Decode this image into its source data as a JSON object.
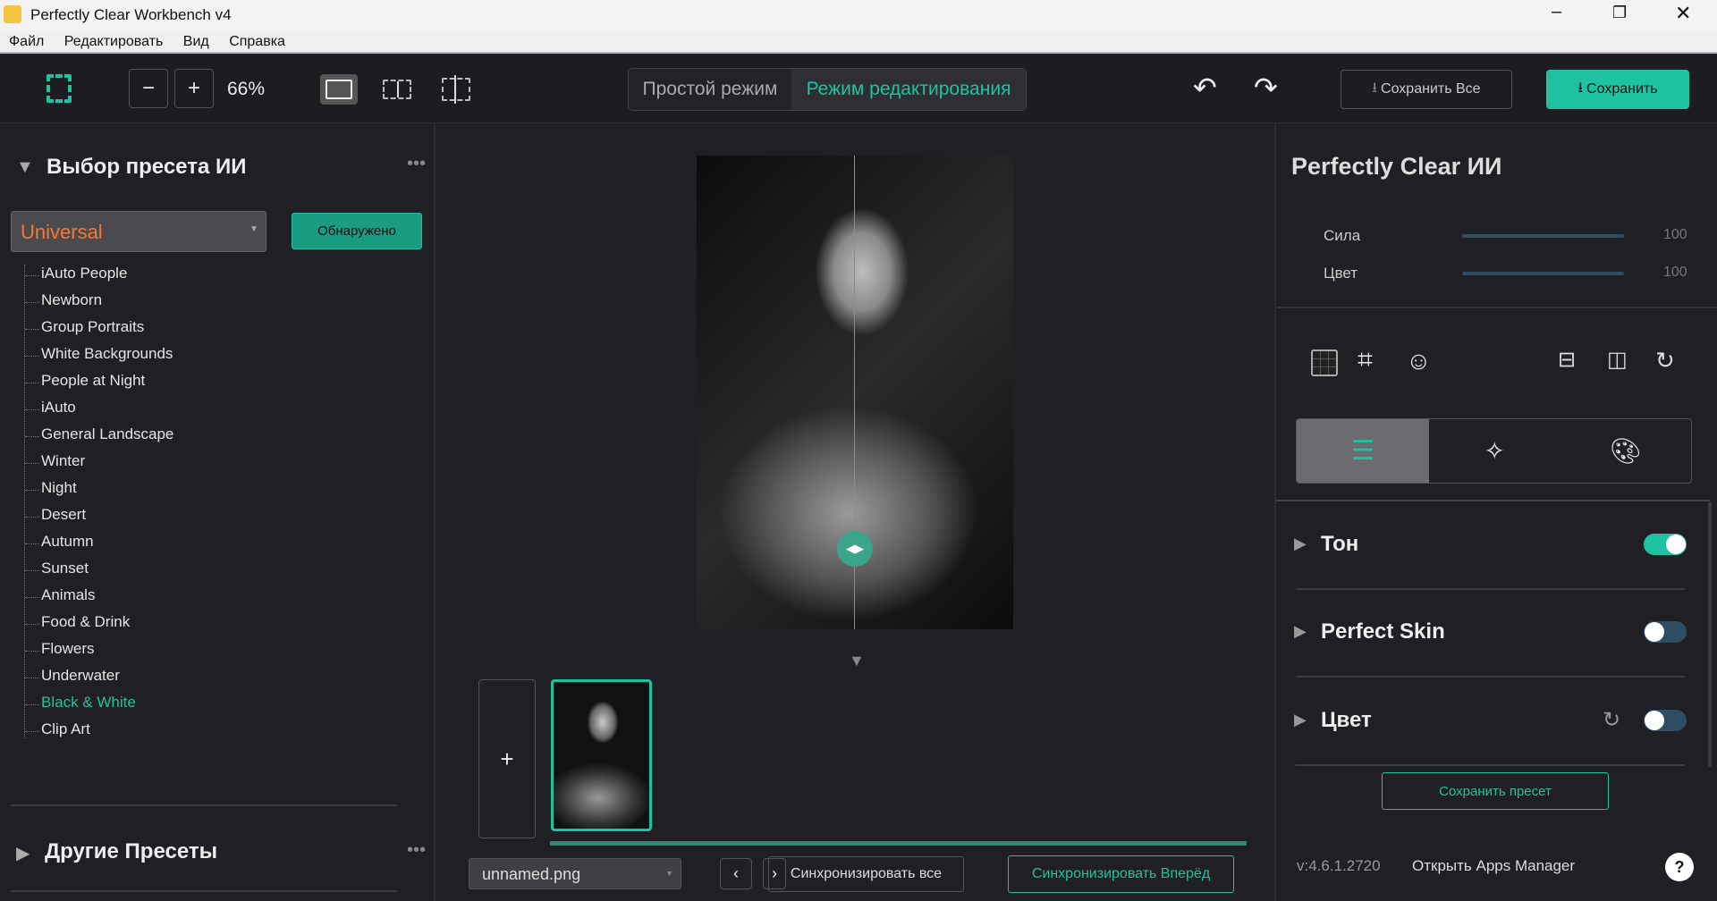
{
  "window": {
    "title": "Perfectly Clear Workbench v4",
    "controls": [
      "minimize",
      "restore",
      "close"
    ]
  },
  "menu": [
    "Файл",
    "Редактировать",
    "Вид",
    "Справка"
  ],
  "toolbar": {
    "zoom": "66%",
    "mode_simple": "Простой режим",
    "mode_edit": "Режим редактирования",
    "save_all": "Сохранить Все",
    "save": "Сохранить",
    "accent": "#1fc2a0"
  },
  "left": {
    "title": "Выбор пресета ИИ",
    "preset_selected": "Universal",
    "detected": "Обнаружено",
    "presets": [
      "iAuto People",
      "Newborn",
      "Group Portraits",
      "White Backgrounds",
      "People at Night",
      "iAuto",
      "General Landscape",
      "Winter",
      "Night",
      "Desert",
      "Autumn",
      "Sunset",
      "Animals",
      "Food & Drink",
      "Flowers",
      "Underwater",
      "Black & White",
      "Clip Art"
    ],
    "active_preset": "Black & White",
    "other_title": "Другие Пресеты"
  },
  "center": {
    "filename": "unnamed.png",
    "sync_all": "Синхронизировать все",
    "sync_forward": "Синхронизировать Вперёд",
    "add": "+"
  },
  "right": {
    "title": "Perfectly Clear ИИ",
    "sliders": [
      {
        "label": "Сила",
        "value": "100"
      },
      {
        "label": "Цвет",
        "value": "100"
      }
    ],
    "sections": [
      {
        "label": "Тон",
        "enabled": true
      },
      {
        "label": "Perfect Skin",
        "enabled": false
      },
      {
        "label": "Цвет",
        "enabled": false
      }
    ],
    "save_preset": "Сохранить пресет",
    "version": "v:4.6.1.2720",
    "apps_manager": "Открыть Apps Manager",
    "help": "?"
  }
}
